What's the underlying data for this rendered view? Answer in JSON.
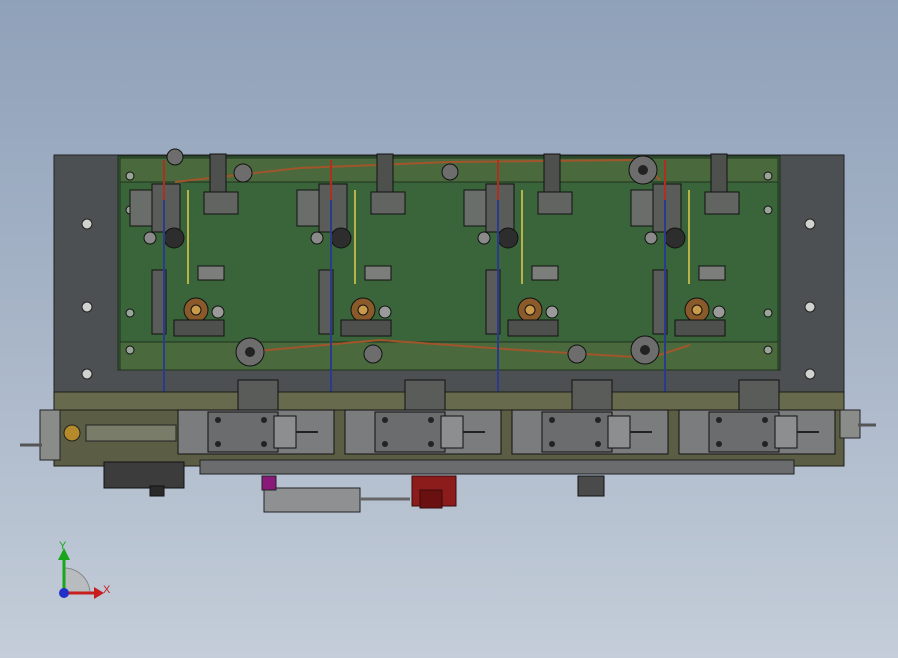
{
  "viewport": {
    "background_top": "#8fa1b9",
    "background_bottom": "#c4cdd9"
  },
  "assembly": {
    "frame_color": "#4d5052",
    "plate_color": "#355c35",
    "base_color": "#5b5e44",
    "station_count": 4,
    "belt_color": "#a0552a",
    "rod_blue": "#2a3a8c",
    "rod_red": "#b03020",
    "cylinder_color": "#8c1c1c",
    "magenta_block": "#8a1a7a"
  },
  "triad": {
    "y_label": "Y",
    "x_label": "X",
    "y_color": "#1aa51a",
    "x_color": "#c81e1e",
    "z_color": "#2030c8"
  }
}
